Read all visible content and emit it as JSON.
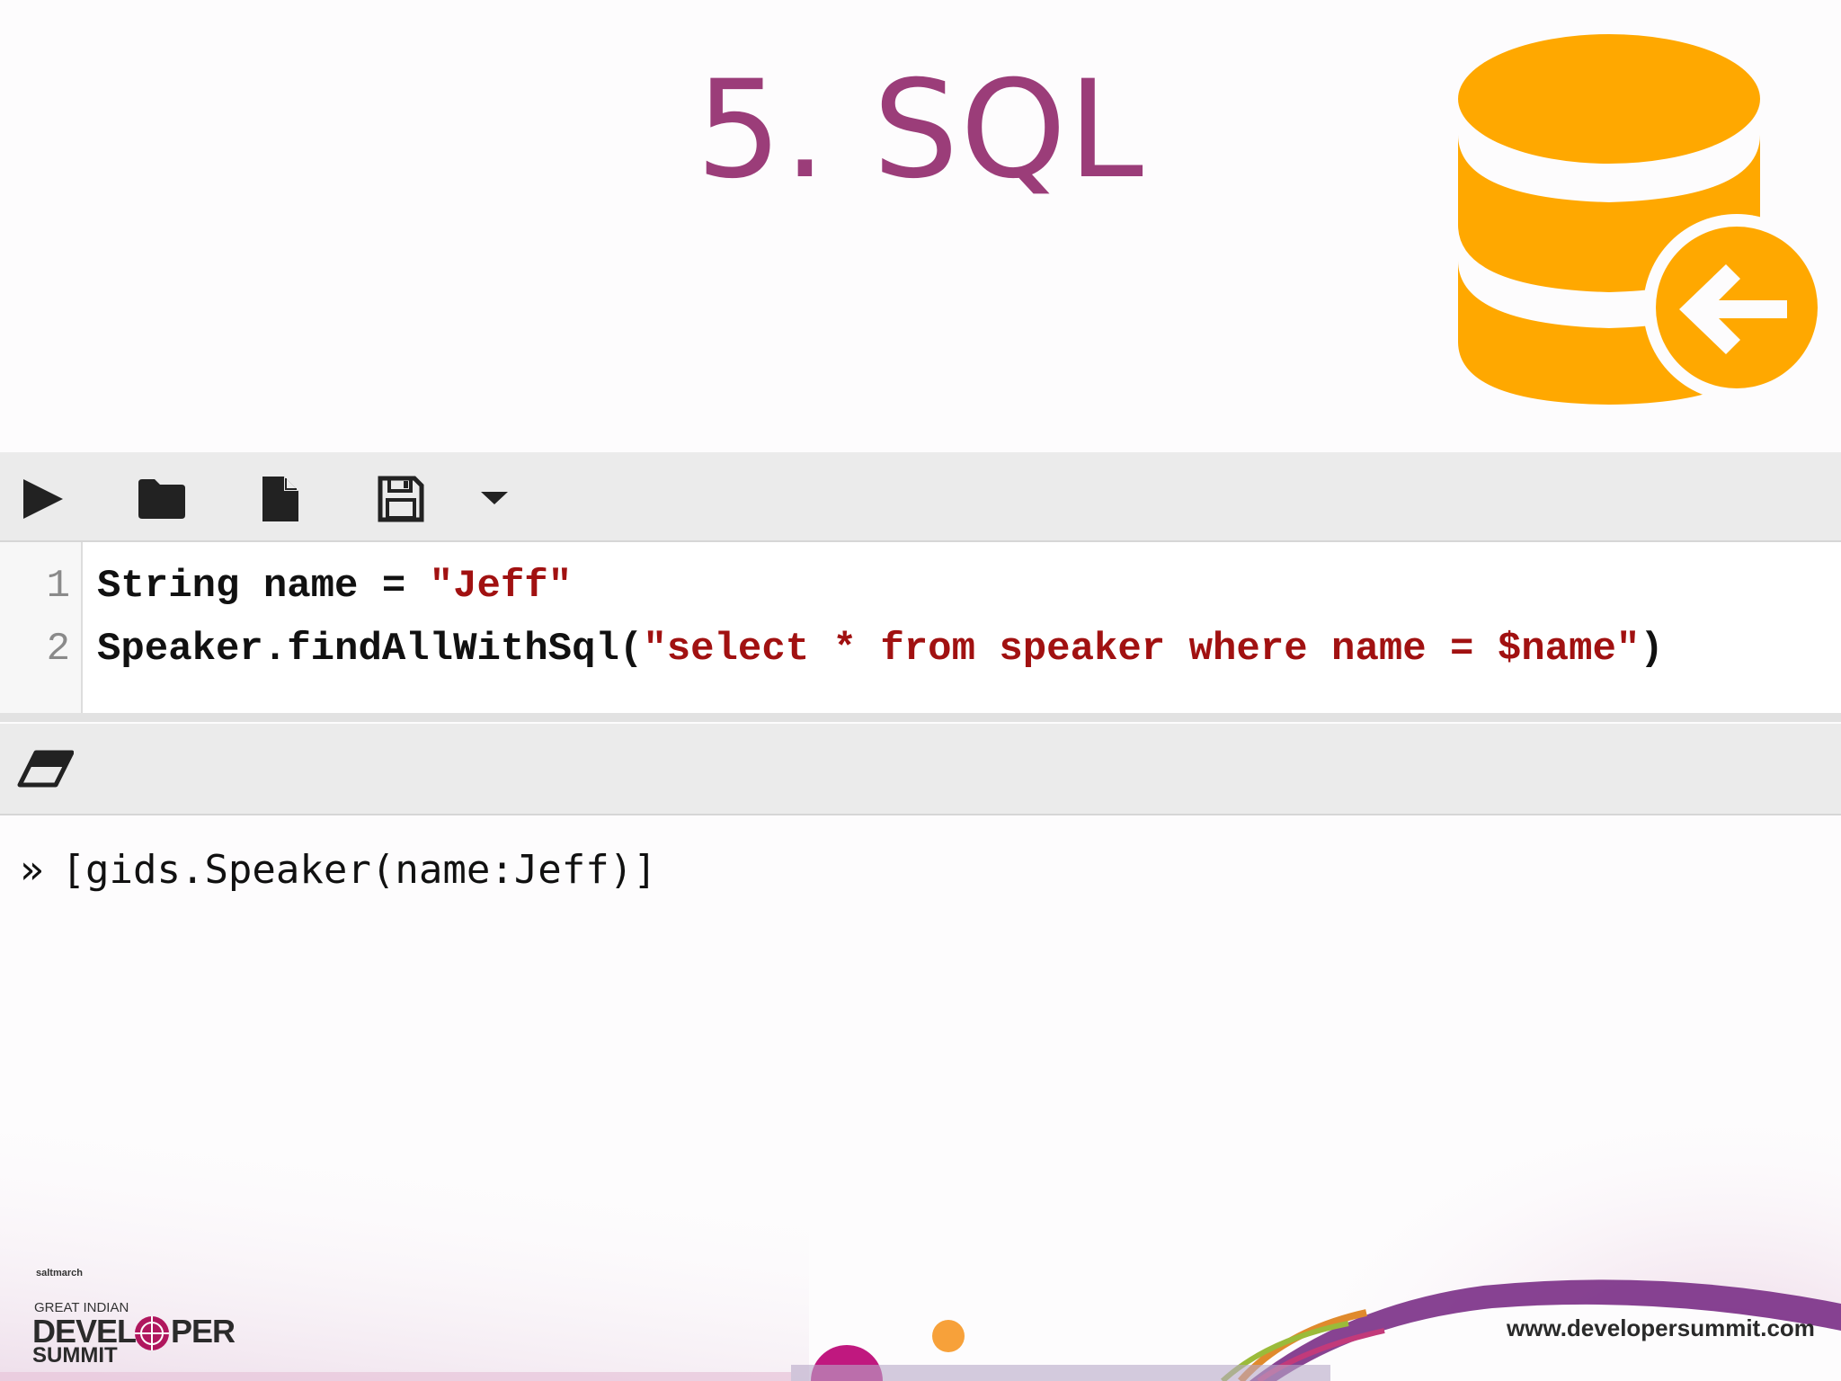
{
  "slide": {
    "title": "5. SQL",
    "accent_color": "#9b3d79",
    "icon_color": "#ffa800"
  },
  "toolbar": {
    "buttons": [
      {
        "name": "run",
        "icon": "play-icon"
      },
      {
        "name": "open",
        "icon": "folder-icon"
      },
      {
        "name": "new",
        "icon": "file-icon"
      },
      {
        "name": "save",
        "icon": "floppy-disk-icon"
      },
      {
        "name": "more",
        "icon": "caret-down-icon"
      }
    ]
  },
  "editor": {
    "lines": [
      {
        "no": "1",
        "code": "String name = ",
        "string": "\"Jeff\"",
        "tail": ""
      },
      {
        "no": "2",
        "code": "Speaker.findAllWithSql(",
        "string": "\"select * from speaker where name = $name\"",
        "tail": ")"
      }
    ]
  },
  "console": {
    "clear_icon": "eraser-icon",
    "prompt": "»",
    "output": "[gids.Speaker(name:Jeff)]"
  },
  "footer": {
    "brand_small": "saltmarch",
    "brand_line1": "GREAT INDIAN",
    "brand_line2a": "DEVEL",
    "brand_line2b": "PER",
    "brand_line3": "SUMMIT",
    "url": "www.developersummit.com"
  }
}
